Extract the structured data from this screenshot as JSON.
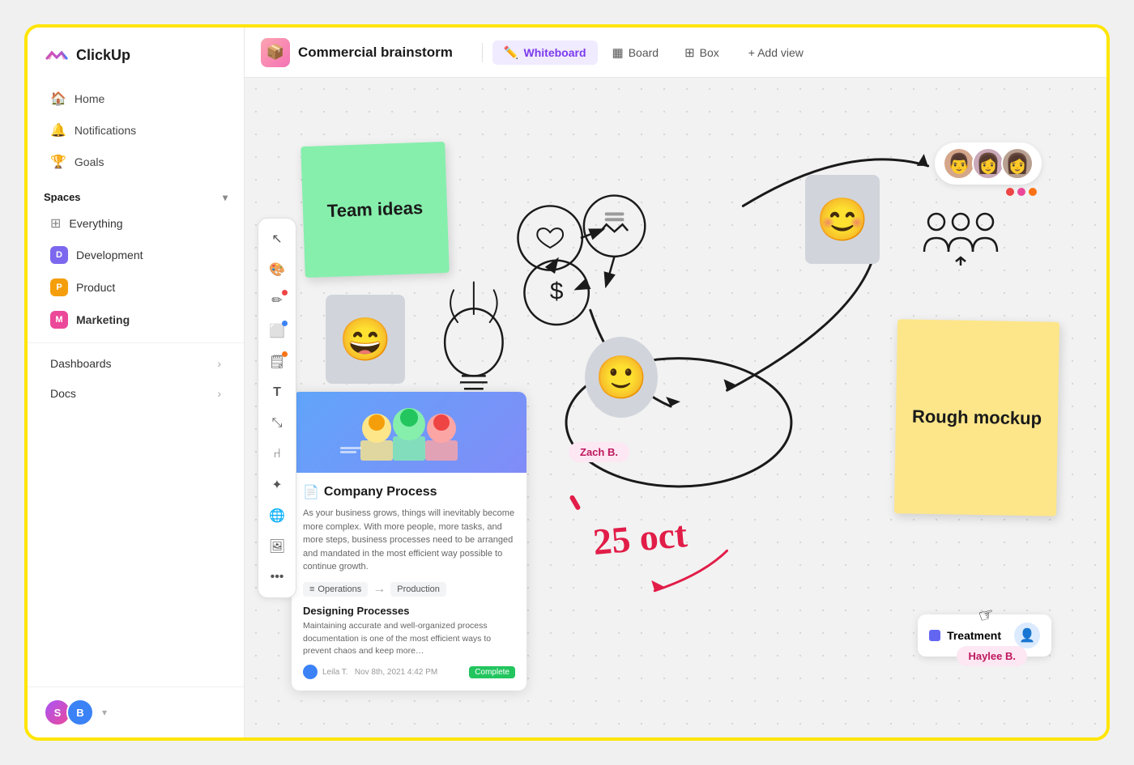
{
  "app": {
    "name": "ClickUp"
  },
  "sidebar": {
    "nav_items": [
      {
        "id": "home",
        "label": "Home",
        "icon": "🏠"
      },
      {
        "id": "notifications",
        "label": "Notifications",
        "icon": "🔔"
      },
      {
        "id": "goals",
        "label": "Goals",
        "icon": "🏆"
      }
    ],
    "spaces_label": "Spaces",
    "space_items": [
      {
        "id": "everything",
        "label": "Everything",
        "type": "everything"
      },
      {
        "id": "development",
        "label": "Development",
        "letter": "D",
        "color": "#7B68EE"
      },
      {
        "id": "product",
        "label": "Product",
        "letter": "P",
        "color": "#F59E0B"
      },
      {
        "id": "marketing",
        "label": "Marketing",
        "letter": "M",
        "color": "#EC4899",
        "bold": true
      }
    ],
    "bottom_items": [
      {
        "id": "dashboards",
        "label": "Dashboards"
      },
      {
        "id": "docs",
        "label": "Docs"
      }
    ],
    "footer": {
      "avatar1_letter": "S",
      "avatar2_letter": "B"
    }
  },
  "topbar": {
    "project_icon": "📦",
    "project_title": "Commercial brainstorm",
    "tabs": [
      {
        "id": "whiteboard",
        "label": "Whiteboard",
        "icon": "✏️",
        "active": true
      },
      {
        "id": "board",
        "label": "Board",
        "icon": "▦"
      },
      {
        "id": "box",
        "label": "Box",
        "icon": "⊞"
      }
    ],
    "add_view_label": "+ Add view"
  },
  "toolbar": {
    "buttons": [
      {
        "id": "cursor",
        "icon": "↖",
        "dot": null
      },
      {
        "id": "palette",
        "icon": "🎨",
        "dot": null
      },
      {
        "id": "pencil",
        "icon": "✏",
        "dot": "red"
      },
      {
        "id": "rect",
        "icon": "⬜",
        "dot": "blue"
      },
      {
        "id": "note",
        "icon": "🗒",
        "dot": "orange"
      },
      {
        "id": "text",
        "icon": "T",
        "dot": null
      },
      {
        "id": "transform",
        "icon": "⤡",
        "dot": null
      },
      {
        "id": "share",
        "icon": "⑁",
        "dot": null
      },
      {
        "id": "sparkle",
        "icon": "✦",
        "dot": null
      },
      {
        "id": "globe",
        "icon": "🌐",
        "dot": null
      },
      {
        "id": "image",
        "icon": "🖼",
        "dot": null
      },
      {
        "id": "more",
        "icon": "…",
        "dot": null
      }
    ]
  },
  "canvas": {
    "sticky_green": {
      "text": "Team ideas"
    },
    "sticky_yellow": {
      "text": "Rough mockup"
    },
    "doc_card": {
      "title": "Company Process",
      "body": "As your business grows, things will inevitably become more complex. With more people, more tasks, and more steps, business processes need to be arranged and mandated in the most efficient way possible to continue growth.",
      "tag1": "Operations",
      "tag2": "Production",
      "section_title": "Designing Processes",
      "section_text": "Maintaining accurate and well-organized process documentation is one of the most efficient ways to prevent chaos and keep more…",
      "footer_name": "Leila T.",
      "footer_date": "Nov 8th, 2021  4:42 PM",
      "footer_badge": "Complete"
    },
    "date_annotation": "25 oct",
    "user_badges": [
      {
        "id": "zach",
        "label": "Zach B."
      },
      {
        "id": "haylee",
        "label": "Haylee B."
      }
    ],
    "treatment_card": {
      "label": "Treatment"
    },
    "avatars": [
      {
        "id": "av1",
        "color": "#d1b89a"
      },
      {
        "id": "av2",
        "color": "#c4a0b4"
      },
      {
        "id": "av3",
        "color": "#b8a09a"
      }
    ],
    "avatar_dots": [
      {
        "color": "#ef4444"
      },
      {
        "color": "#ec4899"
      },
      {
        "color": "#f97316"
      }
    ]
  }
}
